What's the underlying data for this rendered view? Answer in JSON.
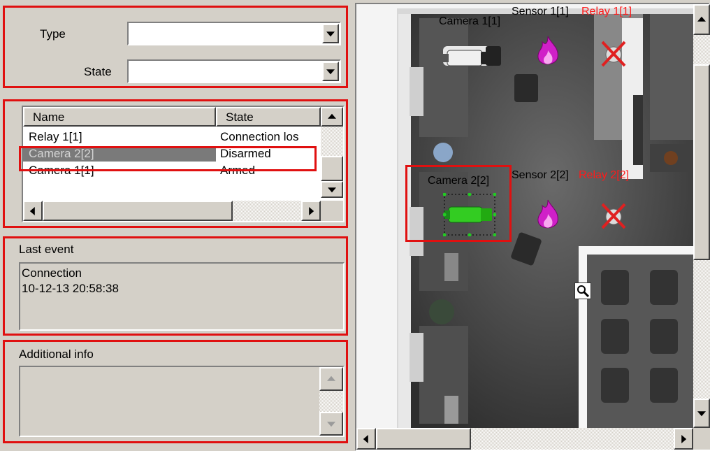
{
  "filters": {
    "type_label": "Type",
    "type_value": "",
    "state_label": "State",
    "state_value": ""
  },
  "objects_table": {
    "columns": [
      "Name",
      "State"
    ],
    "rows": [
      {
        "name": "Relay 1[1]",
        "state": "Connection los",
        "selected": false
      },
      {
        "name": "Camera 2[2]",
        "state": "Disarmed",
        "selected": true
      },
      {
        "name": "Camera 1[1]",
        "state": "Armed",
        "selected": false
      }
    ]
  },
  "last_event": {
    "title": "Last event",
    "lines": [
      "Connection",
      "10-12-13 20:58:38"
    ]
  },
  "additional_info": {
    "title": "Additional info",
    "text": ""
  },
  "map": {
    "labels": {
      "camera1": "Camera 1[1]",
      "sensor1": "Sensor 1[1]",
      "relay1": "Relay 1[1]",
      "camera2": "Camera 2[2]",
      "sensor2": "Sensor 2[2]",
      "relay2": "Relay 2[2]"
    }
  },
  "colors": {
    "highlight_red": "#e01010",
    "relay_label": "#ff1a1a",
    "selected_row_bg": "#7a7a7a",
    "camera_active": "#33cc22",
    "sensor_fire": "#d020c8"
  },
  "icons": {
    "sensor": "fire-icon",
    "relay": "relay-x-icon",
    "camera": "camera-icon",
    "zoom": "magnifier-icon"
  }
}
